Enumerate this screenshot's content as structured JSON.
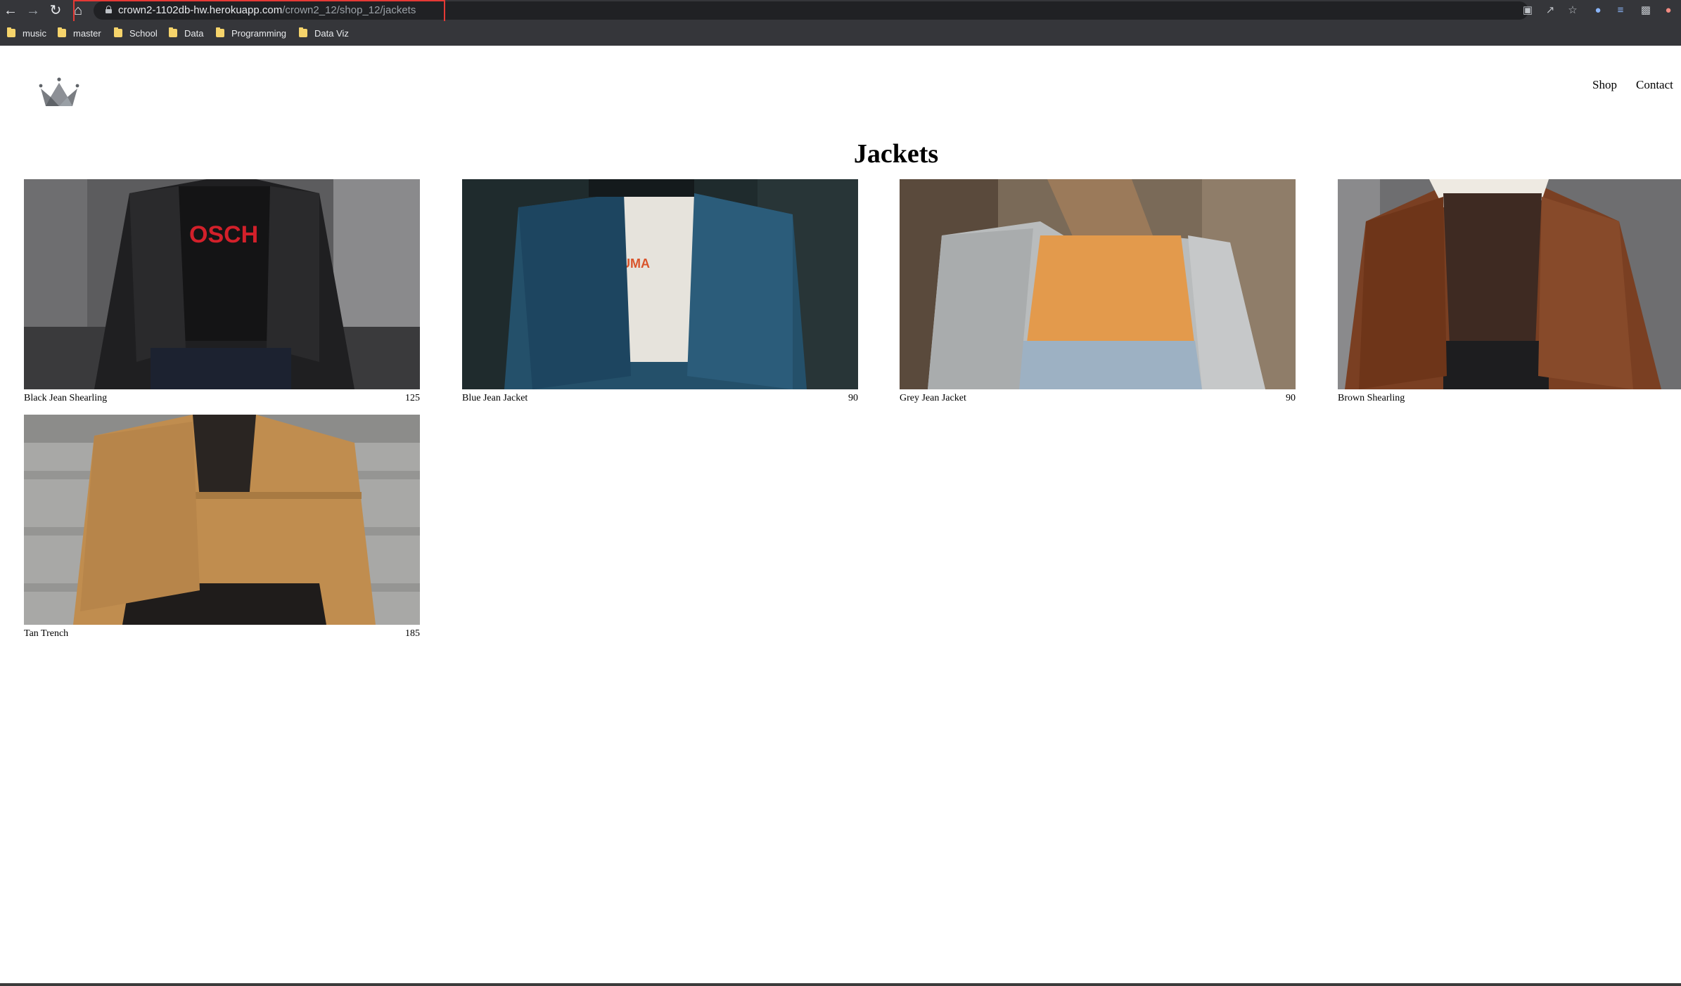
{
  "browser": {
    "url_host": "crown2-1102db-hw.herokuapp.com",
    "url_path": "/crown2_12/shop_12/jackets",
    "bookmarks": [
      "music",
      "master",
      "School",
      "Data",
      "Programming",
      "Data Viz"
    ],
    "icons": [
      "back-icon",
      "forward-icon",
      "reload-icon",
      "home-icon",
      "translate-icon",
      "share-icon",
      "star-icon",
      "extension-icon",
      "profile-icon"
    ]
  },
  "header": {
    "logo": "crown-logo",
    "nav": [
      "Shop",
      "Contact"
    ]
  },
  "collection": {
    "title": "Jackets",
    "items": [
      {
        "name": "Black Jean Shearling",
        "price": "125"
      },
      {
        "name": "Blue Jean Jacket",
        "price": "90"
      },
      {
        "name": "Grey Jean Jacket",
        "price": "90"
      },
      {
        "name": "Brown Shearling",
        "price": ""
      },
      {
        "name": "Tan Trench",
        "price": "185"
      }
    ]
  }
}
